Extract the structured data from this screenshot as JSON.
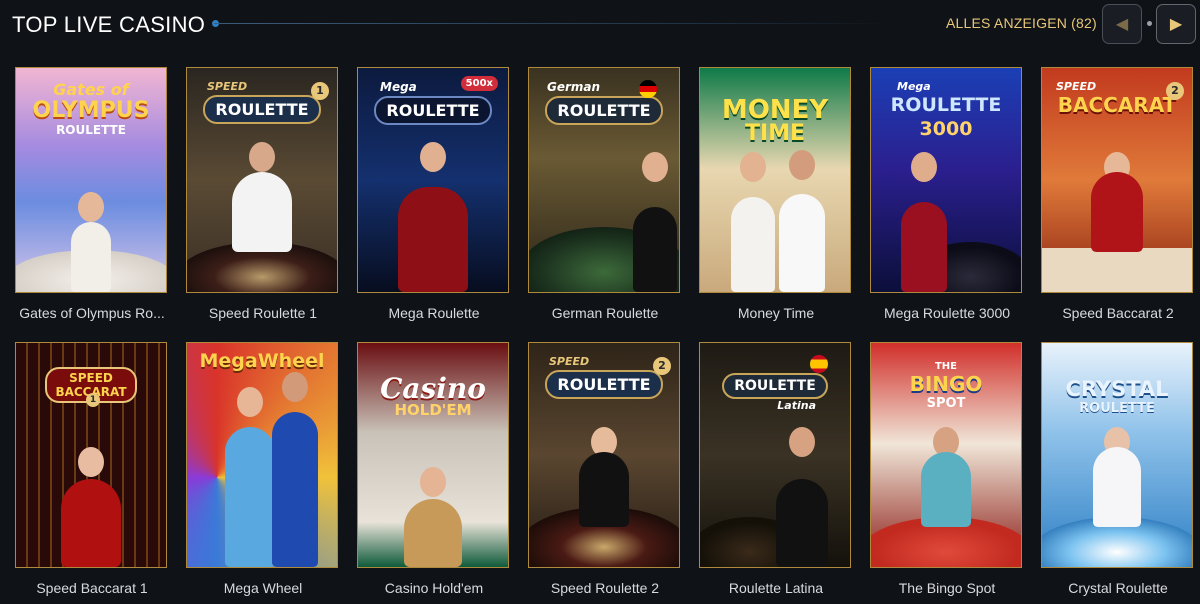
{
  "section": {
    "title": "TOP LIVE CASINO",
    "show_all": "ALLES ANZEIGEN (82)",
    "prev_icon": "chevron-left-icon",
    "next_icon": "chevron-right-icon"
  },
  "colors": {
    "gold": "#e8c77a",
    "card_border": "#b08a3c",
    "background": "#0f1216"
  },
  "games": [
    {
      "name": "Gates of Olympus Ro...",
      "logo_top": "Gates of",
      "logo_main": "OLYMPUS",
      "logo_sub": "ROULETTE"
    },
    {
      "name": "Speed Roulette 1",
      "logo_top": "SPEED",
      "logo_main": "ROULETTE",
      "badge": "1"
    },
    {
      "name": "Mega Roulette",
      "logo_top": "Mega",
      "logo_main": "ROULETTE",
      "logo_sub": "500x"
    },
    {
      "name": "German Roulette",
      "logo_top": "German",
      "logo_main": "ROULETTE"
    },
    {
      "name": "Money Time",
      "logo_top": "MONEY",
      "logo_main": "TIME"
    },
    {
      "name": "Mega Roulette 3000",
      "logo_top": "Mega",
      "logo_main": "ROULETTE",
      "logo_sub": "3000"
    },
    {
      "name": "Speed Baccarat 2",
      "logo_top": "SPEED",
      "logo_main": "BACCARAT",
      "badge": "2"
    },
    {
      "name": "Speed Baccarat 1",
      "logo_top": "SPEED",
      "logo_main": "BACCARAT",
      "badge": "1"
    },
    {
      "name": "Mega Wheel",
      "logo_top": "",
      "logo_main": "MegaWheel"
    },
    {
      "name": "Casino Hold'em",
      "logo_top": "Casino",
      "logo_main": "HOLD'EM"
    },
    {
      "name": "Speed Roulette 2",
      "logo_top": "SPEED",
      "logo_main": "ROULETTE",
      "badge": "2"
    },
    {
      "name": "Roulette Latina",
      "logo_top": "",
      "logo_main": "ROULETTE",
      "logo_sub": "Latina"
    },
    {
      "name": "The Bingo Spot",
      "logo_top": "THE",
      "logo_main": "BINGO",
      "logo_sub": "SPOT"
    },
    {
      "name": "Crystal Roulette",
      "logo_top": "",
      "logo_main": "CRYSTAL",
      "logo_sub": "ROULETTE"
    }
  ]
}
